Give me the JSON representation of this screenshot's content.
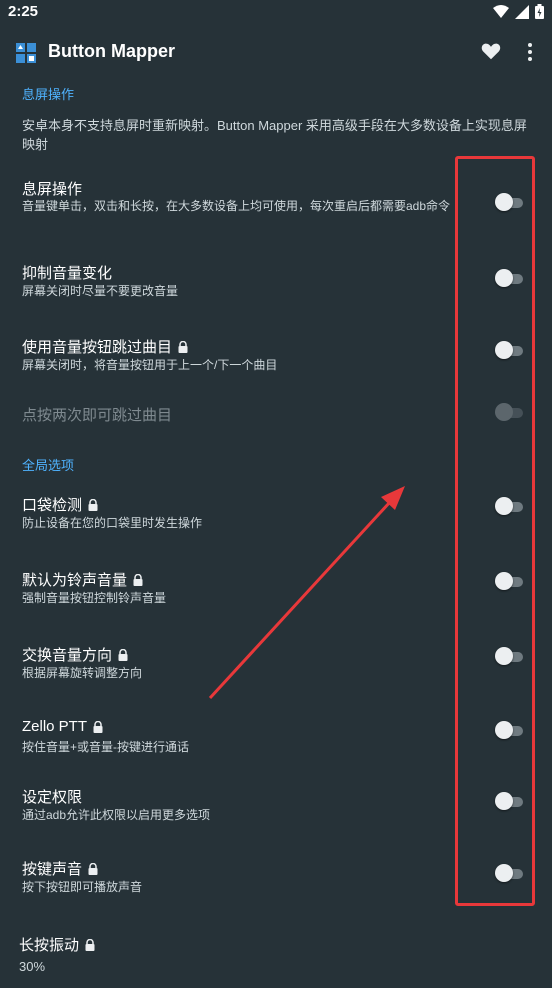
{
  "status_bar": {
    "time": "2:25"
  },
  "app_bar": {
    "title": "Button Mapper"
  },
  "sections": {
    "screen_off": {
      "header": "息屏操作",
      "description": "安卓本身不支持息屏时重新映射。Button Mapper 采用高级手段在大多数设备上实现息屏映射"
    },
    "global": {
      "header": "全局选项"
    }
  },
  "prefs": [
    {
      "title": "息屏操作",
      "summary": "音量键单击，双击和长按，在大多数设备上均可使用，每次重启后都需要adb命令",
      "locked": false,
      "enabled": true
    },
    {
      "title": "抑制音量变化",
      "summary": "屏幕关闭时尽量不要更改音量",
      "locked": false,
      "enabled": true
    },
    {
      "title": "使用音量按钮跳过曲目",
      "summary": "屏幕关闭时，将音量按钮用于上一个/下一个曲目",
      "locked": true,
      "enabled": true
    },
    {
      "title": "点按两次即可跳过曲目",
      "summary": "",
      "locked": false,
      "enabled": false
    },
    {
      "title": "口袋检测",
      "summary": "防止设备在您的口袋里时发生操作",
      "locked": true,
      "enabled": true
    },
    {
      "title": "默认为铃声音量",
      "summary": "强制音量按钮控制铃声音量",
      "locked": true,
      "enabled": true
    },
    {
      "title": "交换音量方向",
      "summary": "根据屏幕旋转调整方向",
      "locked": true,
      "enabled": true
    },
    {
      "title": "Zello PTT",
      "summary": "按住音量+或音量-按键进行通话",
      "locked": true,
      "enabled": true
    },
    {
      "title": "设定权限",
      "summary": "通过adb允许此权限以启用更多选项",
      "locked": false,
      "enabled": true
    },
    {
      "title": "按键声音",
      "summary": "按下按钮即可播放声音",
      "locked": true,
      "enabled": true
    },
    {
      "title": "长按振动",
      "summary": "30%",
      "locked": true,
      "enabled": true
    }
  ],
  "colors": {
    "background": "#263238",
    "accent": "#4fb3ff",
    "annotation": "#e8383a"
  }
}
